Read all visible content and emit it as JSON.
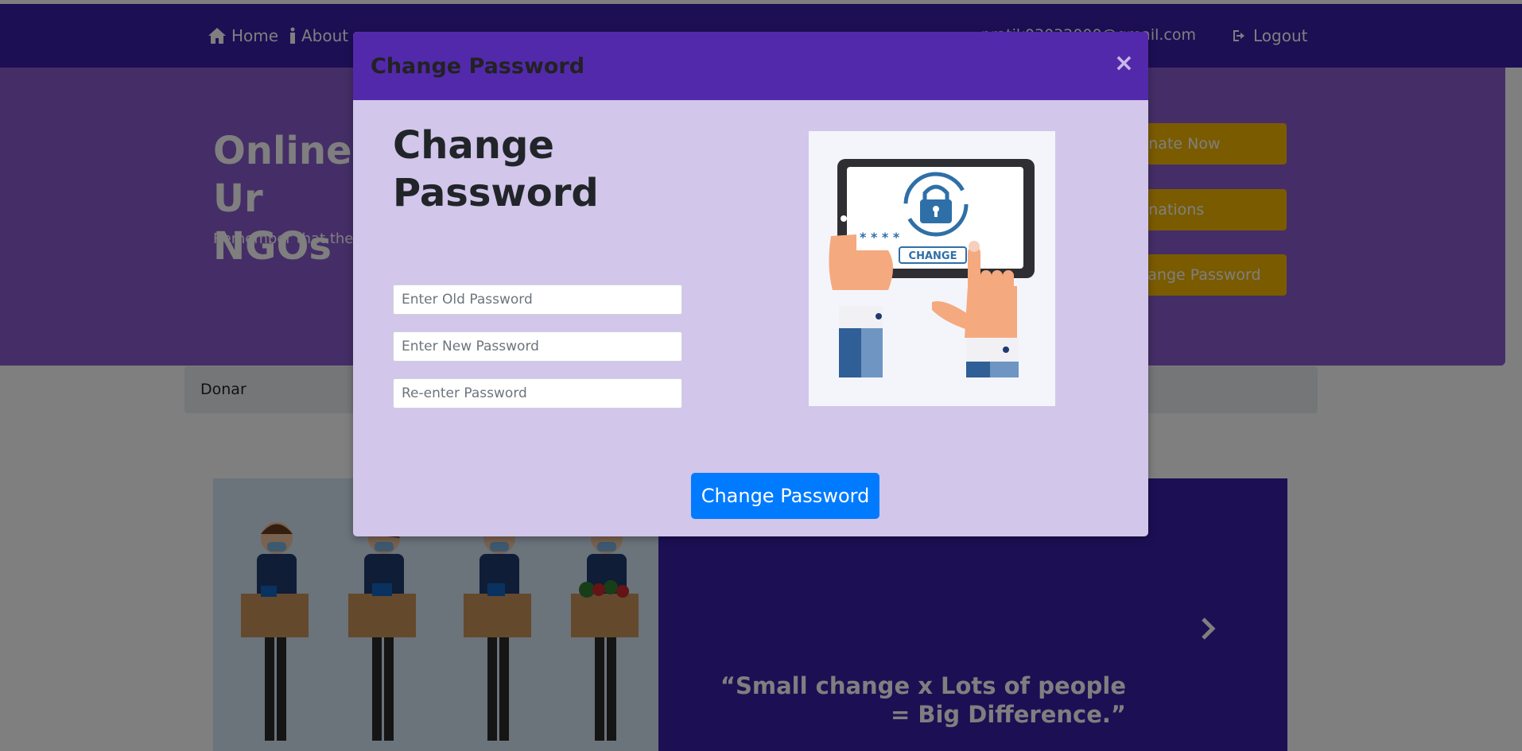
{
  "nav": {
    "home_label": "Home",
    "about_label": "About",
    "email": "pratik03032000@gmail.com",
    "logout_label": "Logout"
  },
  "hero": {
    "title": "Online Ur NGOs",
    "subtitle": "Remember that the",
    "buttons": [
      "Donate Now",
      "Donations",
      "Change Password"
    ]
  },
  "breadcrumb": {
    "text": "Donar"
  },
  "carousel": {
    "quote": "“Small change x Lots of people = Big Difference.”"
  },
  "modal": {
    "title": "Change Password",
    "heading": "Change Password",
    "old_placeholder": "Enter Old Password",
    "new_placeholder": "Enter New Password",
    "reenter_placeholder": "Re-enter Password",
    "submit_label": "Change Password",
    "close_glyph": "×",
    "illustration_text": "CHANGE",
    "illustration_stars": "* * * *"
  },
  "colors": {
    "navbar": "#3b1fa8",
    "hero": "#8a5ccf",
    "accent_button": "#f5b700",
    "modal_header": "#5329ab",
    "modal_body": "#d2c6ea",
    "primary_button": "#007bff"
  }
}
